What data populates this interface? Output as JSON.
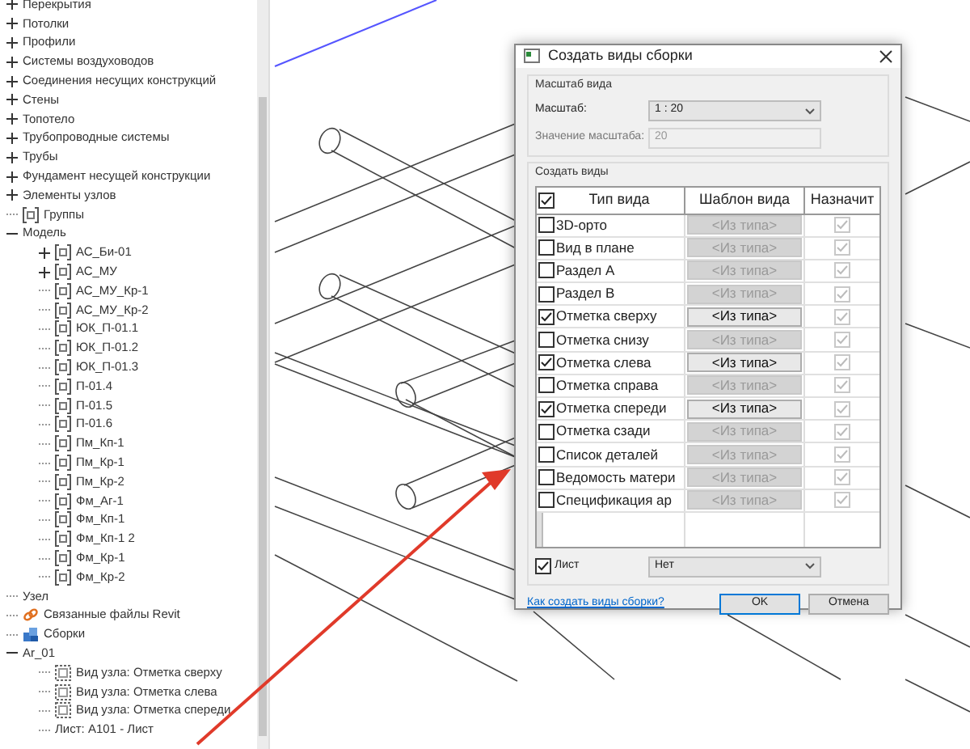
{
  "tree": [
    {
      "label": "Перекрытия",
      "kind": "plain",
      "expanded": false
    },
    {
      "label": "Потолки",
      "kind": "plain",
      "expanded": false
    },
    {
      "label": "Профили",
      "kind": "plain",
      "expanded": false
    },
    {
      "label": "Системы воздуховодов",
      "kind": "plain",
      "expanded": false
    },
    {
      "label": "Соединения несущих конструкций",
      "kind": "plain",
      "expanded": false
    },
    {
      "label": "Стены",
      "kind": "plain",
      "expanded": false
    },
    {
      "label": "Топотело",
      "kind": "plain",
      "expanded": false
    },
    {
      "label": "Трубопроводные системы",
      "kind": "plain",
      "expanded": false
    },
    {
      "label": "Трубы",
      "kind": "plain",
      "expanded": false
    },
    {
      "label": "Фундамент несущей конструкции",
      "kind": "plain",
      "expanded": false
    },
    {
      "label": "Элементы узлов",
      "kind": "plain",
      "expanded": false
    },
    {
      "label": "Группы",
      "kind": "group"
    },
    {
      "label": "Модель",
      "kind": "plain",
      "expanded": true,
      "children": [
        {
          "label": "АС_Би-01",
          "kind": "group",
          "expanded": false
        },
        {
          "label": "АС_МУ",
          "kind": "group",
          "expanded": false
        },
        {
          "label": "АС_МУ_Кр-1",
          "kind": "group"
        },
        {
          "label": "АС_МУ_Кр-2",
          "kind": "group"
        },
        {
          "label": "ЮК_П-01.1",
          "kind": "group"
        },
        {
          "label": "ЮК_П-01.2",
          "kind": "group"
        },
        {
          "label": "ЮК_П-01.3",
          "kind": "group"
        },
        {
          "label": "П-01.4",
          "kind": "group"
        },
        {
          "label": "П-01.5",
          "kind": "group"
        },
        {
          "label": "П-01.6",
          "kind": "group"
        },
        {
          "label": "Пм_Кп-1",
          "kind": "group"
        },
        {
          "label": "Пм_Кр-1",
          "kind": "group"
        },
        {
          "label": "Пм_Кр-2",
          "kind": "group"
        },
        {
          "label": "Фм_Аг-1",
          "kind": "group"
        },
        {
          "label": "Фм_Кп-1",
          "kind": "group"
        },
        {
          "label": "Фм_Кп-1 2",
          "kind": "group"
        },
        {
          "label": "Фм_Кр-1",
          "kind": "group"
        },
        {
          "label": "Фм_Кр-2",
          "kind": "group"
        }
      ]
    },
    {
      "label": "Узел",
      "kind": "plain"
    },
    {
      "label": "Связанные файлы Revit",
      "kind": "link"
    },
    {
      "label": "Сборки",
      "kind": "assembly"
    },
    {
      "label": "Ar_01",
      "kind": "plain",
      "expanded": true,
      "children": [
        {
          "label": "Вид узла: Отметка сверху",
          "kind": "view"
        },
        {
          "label": "Вид узла: Отметка слева",
          "kind": "view"
        },
        {
          "label": "Вид узла: Отметка спереди",
          "kind": "view"
        },
        {
          "label": "Лист: A101 - Лист",
          "kind": "plain"
        }
      ]
    }
  ],
  "dialog": {
    "title": "Создать виды сборки",
    "scale_group": {
      "title": "Масштаб вида",
      "scale_label": "Масштаб:",
      "scale_value": "1 : 20",
      "value_label": "Значение масштаба:",
      "value": "20",
      "value_disabled": true
    },
    "views_group": {
      "title": "Создать виды",
      "all_checked": true,
      "columns": [
        "Тип вида",
        "Шаблон вида",
        "Назначит"
      ],
      "rows": [
        {
          "name": "3D-орто",
          "checked": false,
          "template": "<Из типа>",
          "assign": true
        },
        {
          "name": "Вид в плане",
          "checked": false,
          "template": "<Из типа>",
          "assign": true
        },
        {
          "name": "Раздел А",
          "checked": false,
          "template": "<Из типа>",
          "assign": true
        },
        {
          "name": "Раздел В",
          "checked": false,
          "template": "<Из типа>",
          "assign": true
        },
        {
          "name": "Отметка сверху",
          "checked": true,
          "template": "<Из типа>",
          "assign": true
        },
        {
          "name": "Отметка снизу",
          "checked": false,
          "template": "<Из типа>",
          "assign": true
        },
        {
          "name": "Отметка слева",
          "checked": true,
          "template": "<Из типа>",
          "assign": true
        },
        {
          "name": "Отметка справа",
          "checked": false,
          "template": "<Из типа>",
          "assign": true
        },
        {
          "name": "Отметка спереди",
          "checked": true,
          "template": "<Из типа>",
          "assign": true
        },
        {
          "name": "Отметка сзади",
          "checked": false,
          "template": "<Из типа>",
          "assign": true
        },
        {
          "name": "Список деталей",
          "checked": false,
          "template": "<Из типа>",
          "assign": true
        },
        {
          "name": "Ведомость матери",
          "checked": false,
          "template": "<Из типа>",
          "assign": true
        },
        {
          "name": "Спецификация ар",
          "checked": false,
          "template": "<Из типа>",
          "assign": true
        }
      ]
    },
    "sheet": {
      "label": "Лист",
      "checked": true,
      "value": "Нет"
    },
    "help_link": "Как создать виды сборки?",
    "buttons": [
      {
        "label": "OK",
        "default": true
      },
      {
        "label": "Отмена",
        "default": false
      }
    ]
  }
}
